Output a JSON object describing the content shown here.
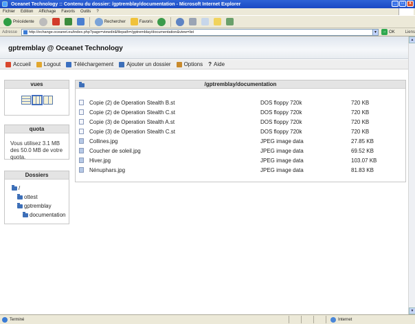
{
  "window": {
    "title": "Oceanet Technology :: Contenu du dossier: /gptremblay/documentation - Microsoft Internet Explorer"
  },
  "menu": [
    "Fichier",
    "Edition",
    "Affichage",
    "Favoris",
    "Outils",
    "?"
  ],
  "toolbar": {
    "back_label": "Précédente",
    "search_label": "Rechercher",
    "favorites_label": "Favoris"
  },
  "address": {
    "label": "Adresse",
    "url": "http://echange.oceanet.eu/index.php?page=viewdir&filepath=/gptremblay/documentation&view=list",
    "go_label": "OK",
    "links_label": "Liens"
  },
  "site": {
    "title": "gptremblay @ Oceanet Technology"
  },
  "nav": [
    {
      "label": "Accueil",
      "color": "#d9462b"
    },
    {
      "label": "Logout",
      "color": "#e2a72e"
    },
    {
      "label": "Téléchargement",
      "color": "#3a6fc0"
    },
    {
      "label": "Ajouter un dossier",
      "color": "#3d6fb8"
    },
    {
      "label": "Options",
      "color": "#c98a2c"
    },
    {
      "label": "Aide",
      "color": "#222222"
    }
  ],
  "sidebar": {
    "views_title": "vues",
    "quota_title": "quota",
    "quota_text": "Vous utilisez 3.1 MB des 50.0 MB de votre quota.",
    "folders_title": "Dossiers",
    "tree": [
      {
        "label": "/",
        "level": 0
      },
      {
        "label": "ottest",
        "level": 1
      },
      {
        "label": "gptremblay",
        "level": 1
      },
      {
        "label": "documentation",
        "level": 2
      }
    ]
  },
  "main": {
    "path": "/gptremblay/documentation",
    "files": [
      {
        "name": "Copie (2) de Operation Stealth B.st",
        "type": "DOS floppy 720k",
        "size": "720 KB",
        "kind": "doc"
      },
      {
        "name": "Copie (2) de Operation Stealth C.st",
        "type": "DOS floppy 720k",
        "size": "720 KB",
        "kind": "doc"
      },
      {
        "name": "Copie (3) de Operation Stealth A.st",
        "type": "DOS floppy 720k",
        "size": "720 KB",
        "kind": "doc"
      },
      {
        "name": "Copie (3) de Operation Stealth C.st",
        "type": "DOS floppy 720k",
        "size": "720 KB",
        "kind": "doc"
      },
      {
        "name": "Collines.jpg",
        "type": "JPEG image data",
        "size": "27.85 KB",
        "kind": "img"
      },
      {
        "name": "Coucher de soleil.jpg",
        "type": "JPEG image data",
        "size": "69.52 KB",
        "kind": "img"
      },
      {
        "name": "Hiver.jpg",
        "type": "JPEG image data",
        "size": "103.07 KB",
        "kind": "img"
      },
      {
        "name": "Nénuphars.jpg",
        "type": "JPEG image data",
        "size": "81.83 KB",
        "kind": "img"
      }
    ]
  },
  "status": {
    "left": "Terminé",
    "zone": "Internet"
  }
}
